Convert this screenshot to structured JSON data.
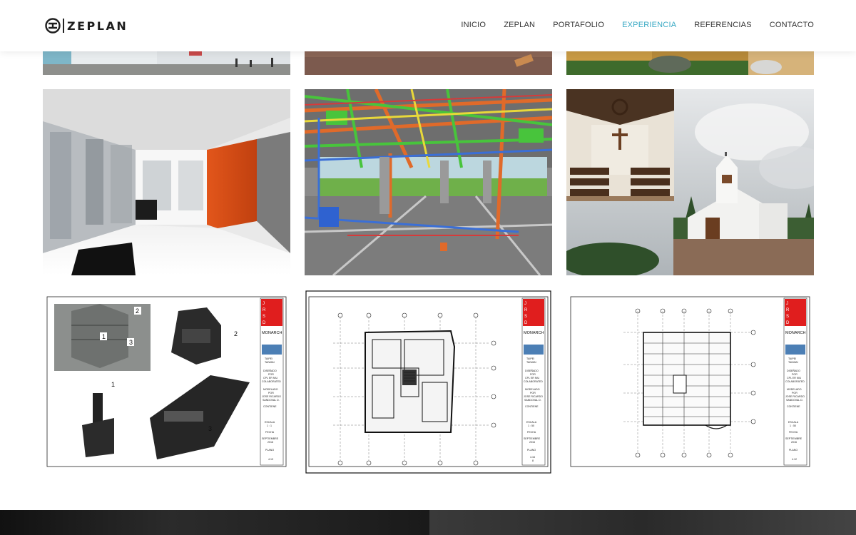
{
  "brand": {
    "name": "ZEPLAN"
  },
  "nav": [
    {
      "label": "INICIO",
      "active": false
    },
    {
      "label": "ZEPLAN",
      "active": false
    },
    {
      "label": "PORTAFOLIO",
      "active": false
    },
    {
      "label": "EXPERIENCIA",
      "active": true
    },
    {
      "label": "REFERENCIAS",
      "active": false
    },
    {
      "label": "CONTACTO",
      "active": false
    }
  ],
  "colors": {
    "accent": "#39a9c4",
    "text": "#333333"
  },
  "sheets": [
    {
      "block": [
        "J",
        "R",
        "S",
        "D"
      ],
      "title": "MONARCH",
      "location": [
        "TAIPEI",
        "TAIWAN"
      ],
      "designed": [
        "DISEÑADO",
        "POR",
        "CPL ER NIU",
        "COLABORATED"
      ],
      "modeled": [
        "MODELADO",
        "POR",
        "JOSE RICARDO",
        "SANDOVAL D."
      ],
      "content": "CONTIENE",
      "scale": [
        "ESCALA",
        "1 : 1"
      ],
      "date": [
        "FECHA",
        "SEPTIEMBRE",
        "2016"
      ],
      "plan": [
        "PLANO",
        "4.13"
      ]
    },
    {
      "block": [
        "J",
        "R",
        "S",
        "D"
      ],
      "title": "MONARCH",
      "location": [
        "TAIPEI",
        "TAIWAN"
      ],
      "designed": [
        "DISEÑADO",
        "POR",
        "CPL ER NIU",
        "COLABORATED"
      ],
      "modeled": [
        "MODELADO",
        "POR",
        "JOSE RICARDO",
        "SANDOVAL D."
      ],
      "content": "CONTIENE",
      "scale": [
        "ESCALA",
        "1 : 50"
      ],
      "date": [
        "FECHA",
        "SEPTIEMBRE",
        "2016"
      ],
      "plan": [
        "PLANO",
        "4.16",
        "8"
      ]
    },
    {
      "block": [
        "J",
        "R",
        "S",
        "D"
      ],
      "title": "MONARCH",
      "location": [
        "TAIPEI",
        "TAIWAN"
      ],
      "designed": [
        "DISEÑADO",
        "POR",
        "CPL ER NIU",
        "COLABORATED"
      ],
      "modeled": [
        "MODELADO",
        "POR",
        "JOSE RICARDO",
        "SANDOVAL D."
      ],
      "content": "CONTIENE",
      "scale": [
        "ESCALA",
        "1 : 50"
      ],
      "date": [
        "FECHA",
        "SEPTIEMBRE",
        "2016"
      ],
      "plan": [
        "PLANO",
        "4.12"
      ]
    }
  ],
  "sheet1_callouts": [
    "1",
    "2",
    "3",
    "2",
    "1",
    "3"
  ]
}
